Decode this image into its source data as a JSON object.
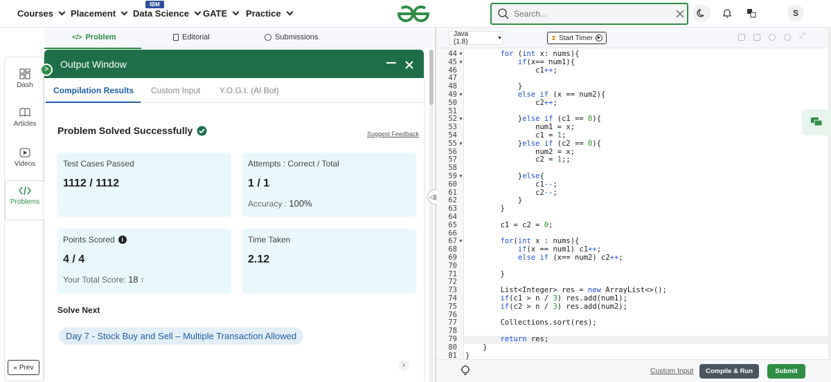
{
  "nav": {
    "courses": "Courses",
    "placement": "Placement",
    "data_science": "Data Science",
    "ibm_badge": "IBM",
    "gate": "GATE",
    "practice": "Practice",
    "search_placeholder": "Search...",
    "avatar_initial": "S"
  },
  "rail": {
    "dash": "Dash",
    "articles": "Articles",
    "videos": "Videos",
    "problems": "Problems",
    "prev": "Prev"
  },
  "tabs": {
    "problem": "Problem",
    "editorial": "Editorial",
    "submissions": "Submissions"
  },
  "output": {
    "title": "Output Window",
    "tabs": [
      "Compilation Results",
      "Custom Input",
      "Y.O.G.I. (AI Bot)"
    ],
    "status": "Problem Solved Successfully",
    "feedback": "Suggest Feedback",
    "test_cases_label": "Test Cases Passed",
    "test_cases_value": "1112 / 1112",
    "attempts_label": "Attempts : Correct / Total",
    "attempts_value": "1 / 1",
    "accuracy_label": "Accuracy :",
    "accuracy_value": "100%",
    "points_label": "Points Scored",
    "points_value": "4 / 4",
    "total_score_label": "Your Total Score:",
    "total_score_value": "18",
    "time_label": "Time Taken",
    "time_value": "2.12",
    "solve_next_heading": "Solve Next",
    "solve_next_item": "Day 7 - Stock Buy and Sell – Multiple Transaction Allowed"
  },
  "editor": {
    "language": "Java (1.8)",
    "timer_label": "Start Timer",
    "custom_input": "Custom Input",
    "compile_run": "Compile & Run",
    "submit": "Submit",
    "lines": [
      {
        "n": "44",
        "fold": true,
        "code": "        for (int x: nums){"
      },
      {
        "n": "45",
        "fold": true,
        "code": "            if(x== num1){"
      },
      {
        "n": "46",
        "fold": false,
        "code": "                c1++;"
      },
      {
        "n": "47",
        "fold": false,
        "code": ""
      },
      {
        "n": "48",
        "fold": false,
        "code": "            }"
      },
      {
        "n": "49",
        "fold": true,
        "code": "            else if (x == num2){"
      },
      {
        "n": "50",
        "fold": false,
        "code": "                c2++;"
      },
      {
        "n": "51",
        "fold": false,
        "code": ""
      },
      {
        "n": "52",
        "fold": true,
        "code": "            }else if (c1 == 0){"
      },
      {
        "n": "53",
        "fold": false,
        "code": "                num1 = x;"
      },
      {
        "n": "54",
        "fold": false,
        "code": "                c1 = 1;"
      },
      {
        "n": "55",
        "fold": true,
        "code": "            }else if (c2 == 0){"
      },
      {
        "n": "56",
        "fold": false,
        "code": "                num2 = x;"
      },
      {
        "n": "57",
        "fold": false,
        "code": "                c2 = 1;;"
      },
      {
        "n": "58",
        "fold": false,
        "code": ""
      },
      {
        "n": "59",
        "fold": true,
        "code": "            }else{"
      },
      {
        "n": "60",
        "fold": false,
        "code": "                c1--;"
      },
      {
        "n": "61",
        "fold": false,
        "code": "                c2--;"
      },
      {
        "n": "62",
        "fold": false,
        "code": "            }"
      },
      {
        "n": "63",
        "fold": false,
        "code": "        }"
      },
      {
        "n": "64",
        "fold": false,
        "code": ""
      },
      {
        "n": "65",
        "fold": false,
        "code": "        c1 = c2 = 0;"
      },
      {
        "n": "66",
        "fold": false,
        "code": ""
      },
      {
        "n": "67",
        "fold": true,
        "code": "        for(int x : nums){"
      },
      {
        "n": "68",
        "fold": false,
        "code": "            if(x == num1) c1++;"
      },
      {
        "n": "69",
        "fold": false,
        "code": "            else if (x== num2) c2++;"
      },
      {
        "n": "70",
        "fold": false,
        "code": ""
      },
      {
        "n": "71",
        "fold": false,
        "code": "        }"
      },
      {
        "n": "72",
        "fold": false,
        "code": ""
      },
      {
        "n": "73",
        "fold": false,
        "code": "        List<Integer> res = new ArrayList<>();"
      },
      {
        "n": "74",
        "fold": false,
        "code": "        if(c1 > n / 3) res.add(num1);"
      },
      {
        "n": "75",
        "fold": false,
        "code": "        if(c2 > n / 3) res.add(num2);"
      },
      {
        "n": "76",
        "fold": false,
        "code": ""
      },
      {
        "n": "77",
        "fold": false,
        "code": "        Collections.sort(res);"
      },
      {
        "n": "78",
        "fold": false,
        "code": ""
      },
      {
        "n": "79",
        "fold": false,
        "code": "        return res;"
      },
      {
        "n": "80",
        "fold": false,
        "code": "    }"
      },
      {
        "n": "81",
        "fold": false,
        "code": "}"
      }
    ]
  },
  "colors": {
    "brand_green": "#2f8d46",
    "output_header": "#1f6e4a",
    "card_bg": "#e9f8fb",
    "link_blue": "#1f5fa8",
    "submit_green": "#2f8d46",
    "compile_btn": "#4a5560"
  },
  "icons": [
    "chevron-down-icon",
    "search-icon",
    "clear-icon",
    "moon-icon",
    "bell-icon",
    "translate-icon",
    "dash-icon",
    "articles-icon",
    "videos-icon",
    "code-icon",
    "check-circle-icon",
    "info-icon",
    "arrow-up-icon",
    "close-icon",
    "minimize-icon",
    "expand-icon",
    "play-icon",
    "lightbulb-icon",
    "chat-icon",
    "double-chevron-left-icon",
    "chevron-right-icon"
  ]
}
